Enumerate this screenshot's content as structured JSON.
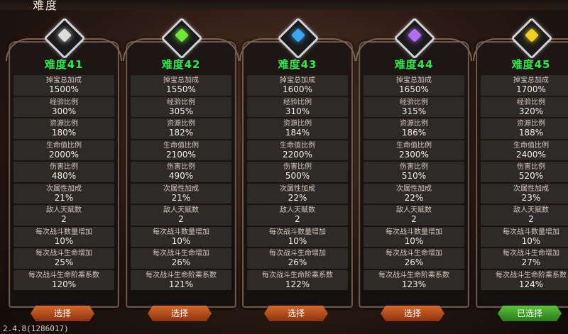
{
  "page_title": "难度",
  "version": "2.4.8(1286017)",
  "cards": [
    {
      "title": "难度41",
      "gem_color": "#dcdcdc",
      "button": "选择",
      "button_style": "orange",
      "rows": [
        [
          "掉宝总加成",
          "1500%"
        ],
        [
          "经验比例",
          "300%"
        ],
        [
          "资源比例",
          "180%"
        ],
        [
          "生命值比例",
          "2000%"
        ],
        [
          "伤害比例",
          "480%"
        ],
        [
          "次属性加成",
          "21%"
        ],
        [
          "敌人天赋数",
          "2"
        ],
        [
          "每次战斗数量增加",
          "10%"
        ],
        [
          "每次战斗生命增加",
          "25%"
        ],
        [
          "每次战斗生命阶乘系数",
          "120%"
        ]
      ]
    },
    {
      "title": "难度42",
      "gem_color": "#6de83a",
      "button": "选择",
      "button_style": "orange",
      "rows": [
        [
          "掉宝总加成",
          "1550%"
        ],
        [
          "经验比例",
          "305%"
        ],
        [
          "资源比例",
          "182%"
        ],
        [
          "生命值比例",
          "2100%"
        ],
        [
          "伤害比例",
          "490%"
        ],
        [
          "次属性加成",
          "21%"
        ],
        [
          "敌人天赋数",
          "2"
        ],
        [
          "每次战斗数量增加",
          "10%"
        ],
        [
          "每次战斗生命增加",
          "26%"
        ],
        [
          "每次战斗生命阶乘系数",
          "121%"
        ]
      ]
    },
    {
      "title": "难度43",
      "gem_color": "#3aa8f0",
      "button": "选择",
      "button_style": "orange",
      "rows": [
        [
          "掉宝总加成",
          "1600%"
        ],
        [
          "经验比例",
          "310%"
        ],
        [
          "资源比例",
          "184%"
        ],
        [
          "生命值比例",
          "2200%"
        ],
        [
          "伤害比例",
          "500%"
        ],
        [
          "次属性加成",
          "22%"
        ],
        [
          "敌人天赋数",
          "2"
        ],
        [
          "每次战斗数量增加",
          "10%"
        ],
        [
          "每次战斗生命增加",
          "26%"
        ],
        [
          "每次战斗生命阶乘系数",
          "122%"
        ]
      ]
    },
    {
      "title": "难度44",
      "gem_color": "#b46df0",
      "button": "选择",
      "button_style": "orange",
      "rows": [
        [
          "掉宝总加成",
          "1650%"
        ],
        [
          "经验比例",
          "315%"
        ],
        [
          "资源比例",
          "186%"
        ],
        [
          "生命值比例",
          "2300%"
        ],
        [
          "伤害比例",
          "510%"
        ],
        [
          "次属性加成",
          "22%"
        ],
        [
          "敌人天赋数",
          "2"
        ],
        [
          "每次战斗数量增加",
          "10%"
        ],
        [
          "每次战斗生命增加",
          "26%"
        ],
        [
          "每次战斗生命阶乘系数",
          "123%"
        ]
      ]
    },
    {
      "title": "难度45",
      "gem_color": "#f0d020",
      "button": "已选择",
      "button_style": "green",
      "rows": [
        [
          "掉宝总加成",
          "1700%"
        ],
        [
          "经验比例",
          "320%"
        ],
        [
          "资源比例",
          "188%"
        ],
        [
          "生命值比例",
          "2400%"
        ],
        [
          "伤害比例",
          "520%"
        ],
        [
          "次属性加成",
          "23%"
        ],
        [
          "敌人天赋数",
          "2"
        ],
        [
          "每次战斗数量增加",
          "10%"
        ],
        [
          "每次战斗生命增加",
          "27%"
        ],
        [
          "每次战斗生命阶乘系数",
          "124%"
        ]
      ]
    }
  ]
}
